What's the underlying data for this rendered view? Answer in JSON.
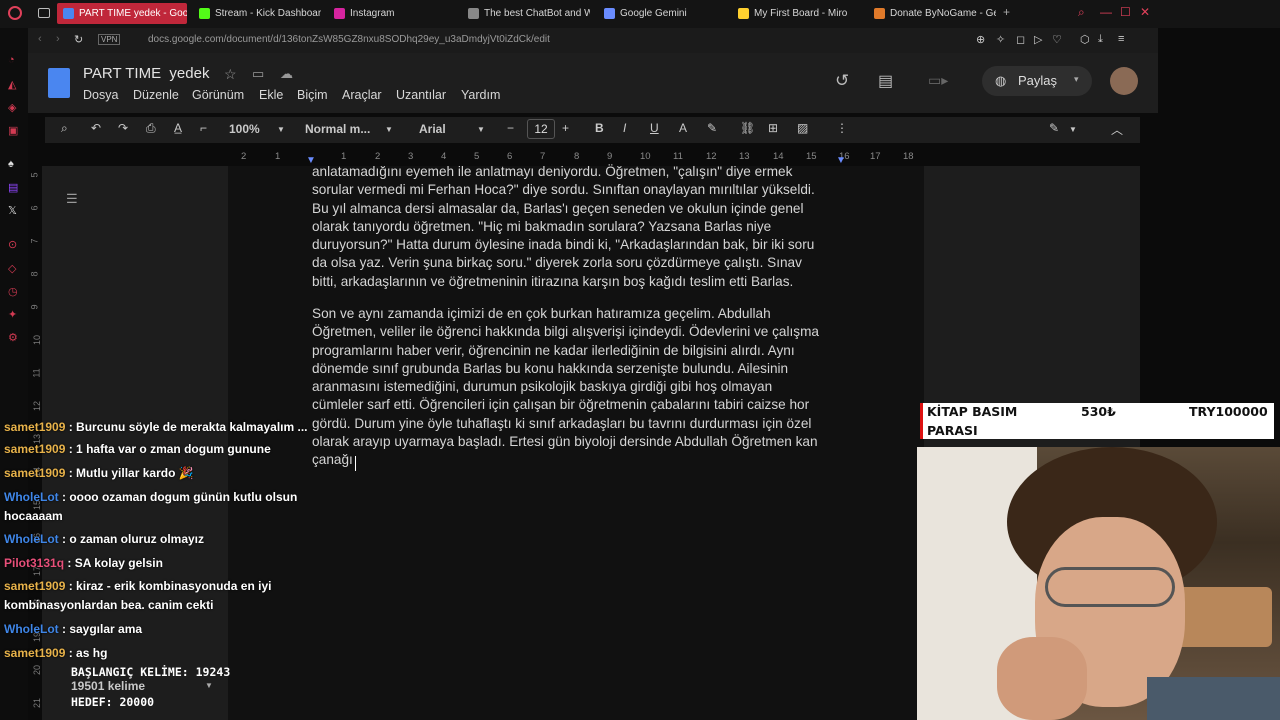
{
  "browser": {
    "tabs": [
      {
        "label": "PART TIME yedek - Goog",
        "active": true,
        "color": "#4a86f0"
      },
      {
        "label": "Stream - Kick Dashboard",
        "active": false,
        "color": "#53fc18"
      },
      {
        "label": "Instagram",
        "active": false,
        "color": "#d6249f"
      },
      {
        "label": "The best ChatBot and W",
        "active": false,
        "color": "#888888"
      },
      {
        "label": "Google Gemini",
        "active": false,
        "color": "#6a8cff"
      },
      {
        "label": "My First Board - Miro",
        "active": false,
        "color": "#ffd02f"
      },
      {
        "label": "Donate ByNoGame - Geli",
        "active": false,
        "color": "#e07a2a"
      }
    ],
    "vpn_label": "VPN",
    "url": "docs.google.com/document/d/136tonZsW85GZ8nxu8SODhq29ey_u3aDmdyjVt0iZdCk/edit"
  },
  "docs": {
    "title": "PART TIME  yedek",
    "menus": [
      "Dosya",
      "Düzenle",
      "Görünüm",
      "Ekle",
      "Biçim",
      "Araçlar",
      "Uzantılar",
      "Yardım"
    ],
    "share_label": "Paylaş",
    "zoom": "100%",
    "style": "Normal m...",
    "font": "Arial",
    "font_size": "12",
    "ruler": [
      "2",
      "1",
      "1",
      "2",
      "3",
      "4",
      "5",
      "6",
      "7",
      "8",
      "9",
      "10",
      "11",
      "12",
      "13",
      "14",
      "15",
      "16",
      "17",
      "18"
    ],
    "vruler": [
      "5",
      "6",
      "7",
      "8",
      "9",
      "10",
      "11",
      "12",
      "13",
      "14",
      "15",
      "16",
      "17",
      "18",
      "19",
      "20",
      "21"
    ],
    "paragraph1": [
      "anlatamadığını eyemeh ile anlatmayı deniyordu. Öğretmen, \"çalışın\" diye ermek",
      "sorular vermedi mi Ferhan Hoca?\" diye sordu. Sınıftan onaylayan mırıltılar yükseldi.",
      "Bu yıl almanca dersi almasalar da, Barlas'ı geçen seneden ve okulun içinde genel",
      "olarak tanıyordu öğretmen. \"Hiç mi bakmadın sorulara? Yazsana Barlas niye",
      "duruyorsun?\" Hatta durum öylesine inada bindi ki, \"Arkadaşlarından bak, bir iki soru",
      "da olsa yaz. Verin şuna birkaç soru.\" diyerek zorla soru çözdürmeye çalıştı. Sınav",
      "bitti, arkadaşlarının ve öğretmeninin itirazına karşın boş kağıdı teslim etti Barlas."
    ],
    "paragraph2": [
      "Son ve aynı zamanda içimizi de en çok burkan hatıramıza geçelim. Abdullah",
      "Öğretmen, veliler ile öğrenci hakkında bilgi alışverişi içindeydi. Ödevlerini ve çalışma",
      "programlarını haber verir, öğrencinin ne kadar ilerlediğinin de bilgisini alırdı. Aynı",
      "dönemde sınıf grubunda Barlas bu konu hakkında serzenişte bulundu. Ailesinin",
      "aranmasını istemediğini, durumun psikolojik baskıya girdiği gibi hoş olmayan",
      "cümleler sarf etti. Öğrencileri için çalışan bir öğretmenin çabalarını tabiri caizse hor",
      "gördü. Durum yine öyle tuhaflaştı ki sınıf arkadaşları bu tavrını durdurması için özel",
      "olarak arayıp uyarmaya başladı. Ertesi gün biyoloji dersinde Abdullah Öğretmen kan",
      "çanağı"
    ]
  },
  "chat": [
    {
      "user": "samet1909",
      "msg": ": Burcunu söyle de merakta kalmayalım ...",
      "color": "#e7b24a",
      "cls": "u"
    },
    {
      "user": "samet1909",
      "msg": ": 1 hafta var o zman dogum gunune",
      "color": "#e7b24a",
      "cls": "u"
    },
    {
      "user": "samet1909",
      "msg": ": Mutlu yillar kardo 🎉",
      "color": "#e7b24a",
      "cls": "u"
    },
    {
      "user": "WholeLot",
      "msg": ": oooo ozaman dogum günün kutlu olsun",
      "msg2": "hocaaaam",
      "color": "#3f86e8",
      "cls": "u w"
    },
    {
      "user": "WholeLot",
      "msg": ": o zaman oluruz olmayız",
      "color": "#3f86e8",
      "cls": "u w"
    },
    {
      "user": "Pilot3131q",
      "msg": ": SA kolay gelsin",
      "color": "#e8507a",
      "cls": "u p"
    },
    {
      "user": "samet1909",
      "msg": ": kiraz - erik kombinasyonuda en iyi",
      "msg2": "kombinasyonlardan bea. canim cekti",
      "color": "#e7b24a",
      "cls": "u"
    },
    {
      "user": "WholeLot",
      "msg": ": saygılar ama",
      "color": "#3f86e8",
      "cls": "u w"
    },
    {
      "user": "samet1909",
      "msg": ": as hg",
      "color": "#e7b24a",
      "cls": "u"
    }
  ],
  "word_counter": {
    "start": "BAŞLANGIÇ KELİME: 19243",
    "current": "19501 kelime",
    "target": "HEDEF: 20000"
  },
  "goal": {
    "label_line1": "KİTAP BASIM",
    "label_line2": "PARASI",
    "current": "530₺",
    "target": "TRY100000"
  }
}
